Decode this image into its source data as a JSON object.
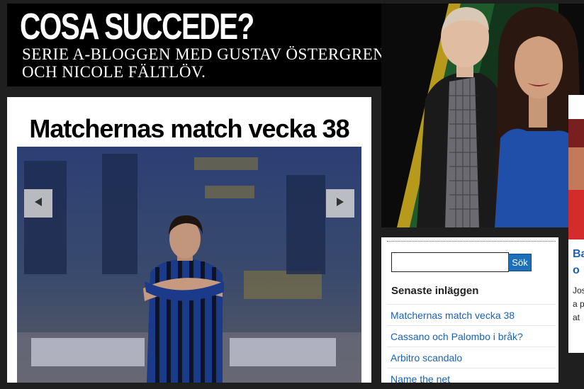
{
  "header": {
    "title": "COSA SUCCEDE?",
    "subtitle_line1": "SERIE A-BLOGGEN MED GUSTAV ÖSTERGREN",
    "subtitle_line2": "OCH NICOLE FÄLTLÖV."
  },
  "post": {
    "title": "Matchernas match vecka 38",
    "prev_icon": "arrow-left-icon",
    "next_icon": "arrow-right-icon"
  },
  "sidebar": {
    "search": {
      "placeholder": "",
      "value": "",
      "button_label": "Sök"
    },
    "latest_heading": "Senaste inläggen",
    "latest_posts": [
      "Matchernas match vecka 38",
      "Cassano och Palombo i bråk?",
      "Arbitro scandalo",
      "Name the net"
    ]
  },
  "right_panel": {
    "headline": "Ba Mo",
    "excerpt": "Jos liga poi kat"
  },
  "colors": {
    "page_background": "#1f1f1f",
    "header_background": "#000000",
    "link_blue": "#1a62b3",
    "button_blue": "#1e6fb9",
    "jersey_blue": "#1b3a8a"
  }
}
